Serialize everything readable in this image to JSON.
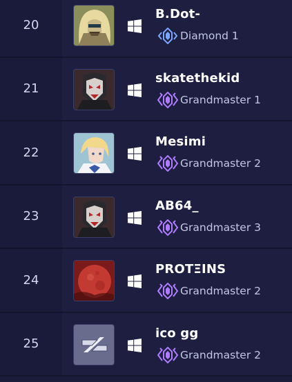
{
  "colors": {
    "background": "#1b1c3c",
    "diamond_badge": "#7aa6ff",
    "grandmaster_badge": "#b07cff"
  },
  "rows": [
    {
      "rank": "20",
      "name": "B.Dot-",
      "tier": "Diamond 1",
      "tier_icon": "diamond-rank-icon",
      "avatar": "hero-portrait-icon"
    },
    {
      "rank": "21",
      "name": "skatethekid",
      "tier": "Grandmaster 1",
      "tier_icon": "grandmaster-rank-icon",
      "avatar": "hero-portrait-icon"
    },
    {
      "rank": "22",
      "name": "Mesimi",
      "tier": "Grandmaster 2",
      "tier_icon": "grandmaster-rank-icon",
      "avatar": "hero-portrait-icon"
    },
    {
      "rank": "23",
      "name": "AB64_",
      "tier": "Grandmaster 3",
      "tier_icon": "grandmaster-rank-icon",
      "avatar": "hero-portrait-icon"
    },
    {
      "rank": "24",
      "name": "PROTΞINS",
      "tier": "Grandmaster 2",
      "tier_icon": "grandmaster-rank-icon",
      "avatar": "red-moon-icon"
    },
    {
      "rank": "25",
      "name": "ico gg",
      "tier": "Grandmaster 2",
      "tier_icon": "grandmaster-rank-icon",
      "avatar": "logo-emblem-icon"
    }
  ]
}
